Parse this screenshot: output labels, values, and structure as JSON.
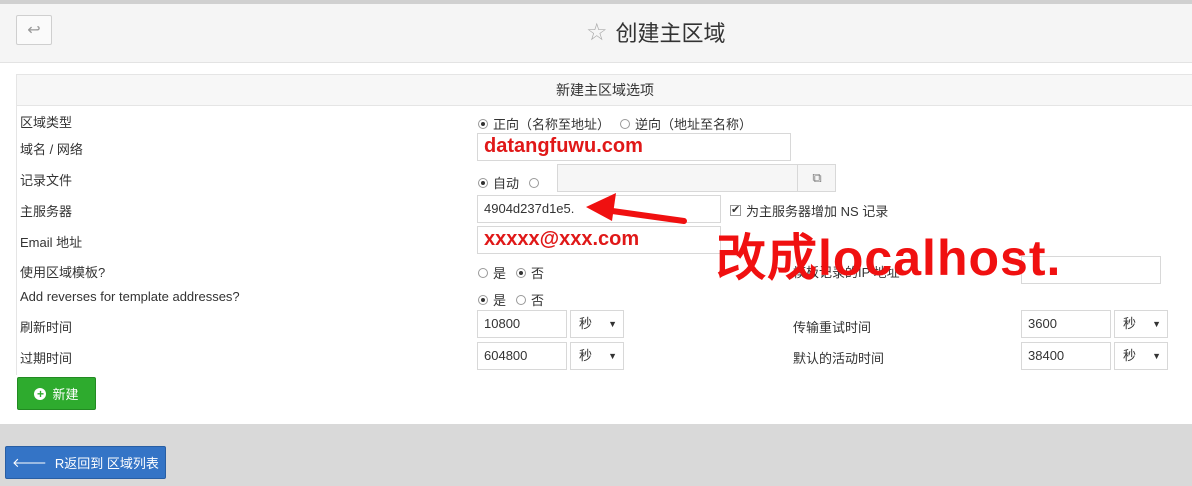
{
  "header": {
    "title": "创建主区域",
    "back_icon": "↩"
  },
  "panel": {
    "title": "新建主区域选项"
  },
  "form": {
    "zone_type": {
      "label": "区域类型",
      "opt1": "正向（名称至地址）",
      "opt2": "逆向（地址至名称）"
    },
    "domain": {
      "label": "域名 / 网络",
      "value": "datangfuwu.com"
    },
    "record_file": {
      "label": "记录文件",
      "opt_auto": "自动"
    },
    "master_server": {
      "label": "主服务器",
      "value": "4904d237d1e5.",
      "checkbox_label": "为主服务器增加 NS 记录"
    },
    "email": {
      "label": "Email 地址",
      "value": "xxxxx@xxx.com"
    },
    "use_template": {
      "label": "使用区域模板?",
      "yes": "是",
      "no": "否",
      "ip_label": "模板记录的IP 地址"
    },
    "add_reverses": {
      "label": "Add reverses for template addresses?",
      "yes": "是",
      "no": "否"
    },
    "refresh": {
      "label": "刷新时间",
      "value": "10800",
      "unit": "秒"
    },
    "retry": {
      "label": "传输重试时间",
      "value": "3600",
      "unit": "秒"
    },
    "expire": {
      "label": "过期时间",
      "value": "604800",
      "unit": "秒"
    },
    "default_ttl": {
      "label": "默认的活动时间",
      "value": "38400",
      "unit": "秒"
    }
  },
  "buttons": {
    "create": "新建",
    "return": "R返回到 区域列表"
  },
  "annotation": {
    "text": "改成localhost."
  },
  "colors": {
    "create": "#2eab2e",
    "return": "#3474c6",
    "annotation": "#f01010"
  }
}
